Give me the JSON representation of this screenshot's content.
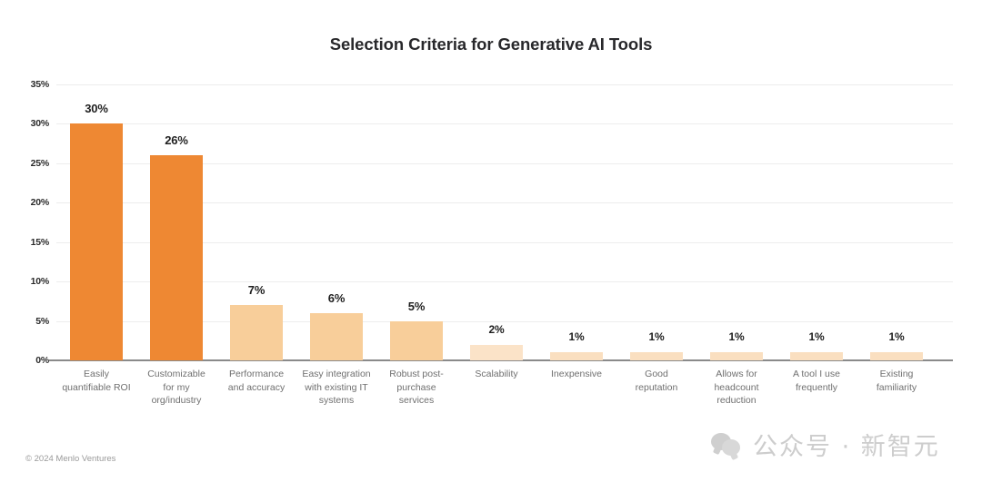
{
  "chart_data": {
    "type": "bar",
    "title": "Selection Criteria for Generative AI Tools",
    "xlabel": "",
    "ylabel": "",
    "ylim": [
      0,
      35
    ],
    "ytick_labels": [
      "35%",
      "30%",
      "25%",
      "20%",
      "15%",
      "10%",
      "5%",
      "0%"
    ],
    "ytick_values": [
      35,
      30,
      25,
      20,
      15,
      10,
      5,
      0
    ],
    "grid": true,
    "legend": "none",
    "categories": [
      "Easily quantifiable ROI",
      "Customizable for my org/industry",
      "Performance and accuracy",
      "Easy integration with existing IT systems",
      "Robust post-purchase services",
      "Scalability",
      "Inexpensive",
      "Good reputation",
      "Allows for headcount reduction",
      "A tool I use frequently",
      "Existing familiarity"
    ],
    "values": [
      30,
      26,
      7,
      6,
      5,
      2,
      1,
      1,
      1,
      1,
      1
    ],
    "value_labels": [
      "30%",
      "26%",
      "7%",
      "6%",
      "5%",
      "2%",
      "1%",
      "1%",
      "1%",
      "1%",
      "1%"
    ],
    "bars": [
      {
        "label_lines": [
          "Easily",
          "quantifiable ROI"
        ],
        "value": 30,
        "value_label": "30%",
        "color": "#ee8833"
      },
      {
        "label_lines": [
          "Customizable",
          "for my",
          "org/industry"
        ],
        "value": 26,
        "value_label": "26%",
        "color": "#ee8833"
      },
      {
        "label_lines": [
          "Performance",
          "and accuracy"
        ],
        "value": 7,
        "value_label": "7%",
        "color": "#f8ce9a"
      },
      {
        "label_lines": [
          "Easy integration",
          "with existing IT",
          "systems"
        ],
        "value": 6,
        "value_label": "6%",
        "color": "#f8ce9a"
      },
      {
        "label_lines": [
          "Robust post-",
          "purchase",
          "services"
        ],
        "value": 5,
        "value_label": "5%",
        "color": "#f8ce9a"
      },
      {
        "label_lines": [
          "Scalability"
        ],
        "value": 2,
        "value_label": "2%",
        "color": "#fbe3c8"
      },
      {
        "label_lines": [
          "Inexpensive"
        ],
        "value": 1,
        "value_label": "1%",
        "color": "#fadfc0"
      },
      {
        "label_lines": [
          "Good",
          "reputation"
        ],
        "value": 1,
        "value_label": "1%",
        "color": "#fadfc0"
      },
      {
        "label_lines": [
          "Allows for",
          "headcount",
          "reduction"
        ],
        "value": 1,
        "value_label": "1%",
        "color": "#fadfc0"
      },
      {
        "label_lines": [
          "A tool I use",
          "frequently"
        ],
        "value": 1,
        "value_label": "1%",
        "color": "#fadfc0"
      },
      {
        "label_lines": [
          "Existing",
          "familiarity"
        ],
        "value": 1,
        "value_label": "1%",
        "color": "#fadfc0"
      }
    ],
    "colors": {
      "bar_primary": "#ee8833",
      "bar_secondary": "#f8ce9a",
      "bar_faint": "#fbe3c8",
      "gridline": "#ededed",
      "axis": "#8a8a8a",
      "title_text": "#28282b",
      "category_text": "#6f6f6f",
      "value_text": "#1f1f1f"
    }
  },
  "footer": {
    "credit": "© 2024 Menlo Ventures"
  },
  "watermark": {
    "icon": "wechat-bubbles-icon",
    "text": "公众号 · 新智元"
  }
}
